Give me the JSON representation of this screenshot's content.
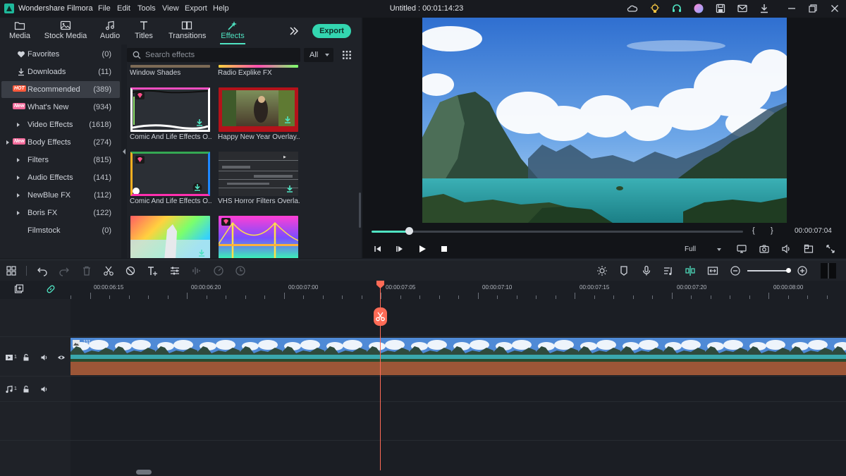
{
  "titlebar": {
    "app_name": "Wondershare Filmora",
    "menus": [
      "File",
      "Edit",
      "Tools",
      "View",
      "Export",
      "Help"
    ],
    "document_title": "Untitled : 00:01:14:23"
  },
  "media_tabs": [
    {
      "label": "Media",
      "icon": "folder-icon"
    },
    {
      "label": "Stock Media",
      "icon": "image-icon"
    },
    {
      "label": "Audio",
      "icon": "music-icon"
    },
    {
      "label": "Titles",
      "icon": "text-icon"
    },
    {
      "label": "Transitions",
      "icon": "transition-icon"
    },
    {
      "label": "Effects",
      "icon": "effects-icon",
      "active": true
    }
  ],
  "export_label": "Export",
  "categories": [
    {
      "label": "Favorites",
      "count": "(0)",
      "icon": "heart-icon"
    },
    {
      "label": "Downloads",
      "count": "(11)",
      "icon": "download-icon"
    },
    {
      "label": "Recommended",
      "count": "(389)",
      "badge": "HOT",
      "selected": true
    },
    {
      "label": "What's New",
      "count": "(934)",
      "badge": "New"
    },
    {
      "label": "Video Effects",
      "count": "(1618)",
      "arrow": true
    },
    {
      "label": "Body Effects",
      "count": "(274)",
      "badge": "New",
      "outer_arrow": true
    },
    {
      "label": "Filters",
      "count": "(815)",
      "arrow": true
    },
    {
      "label": "Audio Effects",
      "count": "(141)",
      "arrow": true
    },
    {
      "label": "NewBlue FX",
      "count": "(112)",
      "arrow": true
    },
    {
      "label": "Boris FX",
      "count": "(122)",
      "arrow": true
    },
    {
      "label": "Filmstock",
      "count": "(0)"
    }
  ],
  "search": {
    "placeholder": "Search effects",
    "value": ""
  },
  "filter_value": "All",
  "effects": [
    {
      "label": "Window Shades"
    },
    {
      "label": "Radio Explike FX"
    },
    {
      "label": "Comic And Life Effects O..."
    },
    {
      "label": "Happy New Year Overlay..."
    },
    {
      "label": "Comic And Life Effects O..."
    },
    {
      "label": "VHS Horror Filters Overla..."
    },
    {
      "label": ""
    },
    {
      "label": ""
    }
  ],
  "preview": {
    "progress": 0.1,
    "mark_in": "{",
    "mark_out": "}",
    "timecode": "00:00:07:04",
    "quality": "Full"
  },
  "ruler_labels": [
    "00:00:06:15",
    "00:00:06:20",
    "00:00:07:00",
    "00:00:07:05",
    "00:00:07:10",
    "00:00:07:15",
    "00:00:07:20",
    "00:00:08:00"
  ],
  "tracks": {
    "video_number": "1",
    "audio_number": "1",
    "clip_name": "111"
  },
  "colors": {
    "accent": "#4fe3c2",
    "export_button": "#33d6b0",
    "playhead": "#ff6b56",
    "audio_waveform": "#9c5637",
    "hot_badge": "#ff5a3c",
    "new_badge": "#f26a9a"
  }
}
